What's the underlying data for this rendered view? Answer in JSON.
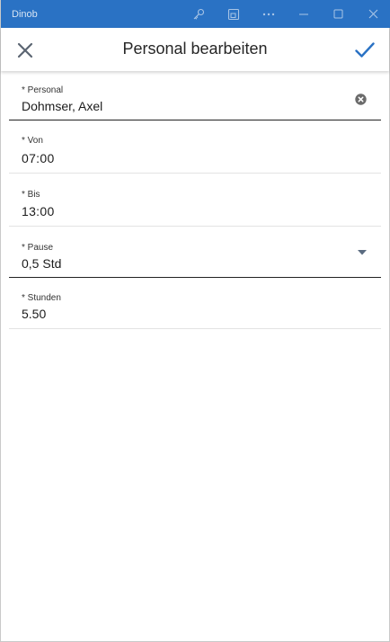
{
  "window": {
    "app_name": "Dinob",
    "icons": [
      "key-icon",
      "app-window-icon",
      "more-icon",
      "minimize-icon",
      "maximize-icon",
      "close-window-icon"
    ]
  },
  "appbar": {
    "title": "Personal bearbeiten",
    "close_icon": "close-icon",
    "save_icon": "checkmark-icon",
    "accent_color": "#2a72c4"
  },
  "form": {
    "personal": {
      "label": "* Personal",
      "value": "Dohmser, Axel",
      "clear_icon": "clear-circle-icon"
    },
    "von": {
      "label": "* Von",
      "value": "07:00"
    },
    "bis": {
      "label": "* Bis",
      "value": "13:00"
    },
    "pause": {
      "label": "* Pause",
      "value": "0,5 Std",
      "dropdown_icon": "caret-down-icon"
    },
    "stunden": {
      "label": "* Stunden",
      "value": "5.50"
    }
  }
}
